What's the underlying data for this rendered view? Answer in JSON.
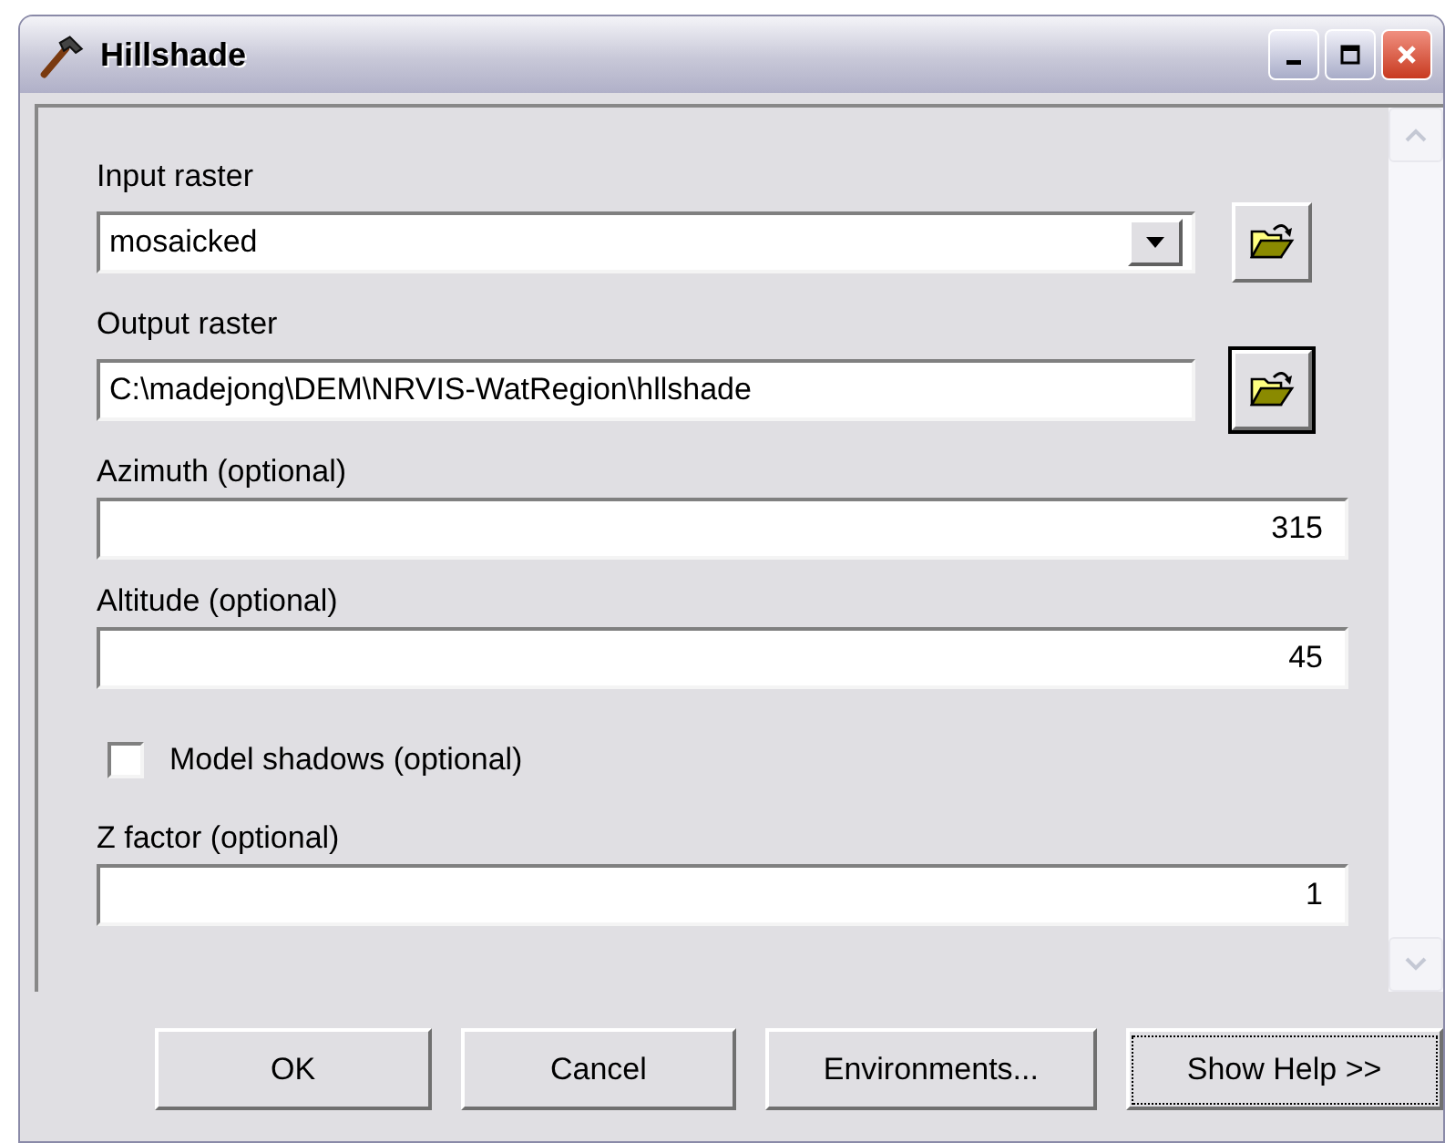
{
  "window": {
    "title": "Hillshade"
  },
  "parameters": [
    {
      "kind": "dropdown",
      "label": "Input raster",
      "value": "mosaicked"
    },
    {
      "kind": "path",
      "label": "Output raster",
      "value": "C:\\madejong\\DEM\\NRVIS-WatRegion\\hllshade"
    },
    {
      "kind": "number",
      "label": "Azimuth (optional)",
      "value": "315"
    },
    {
      "kind": "number",
      "label": "Altitude (optional)",
      "value": "45"
    },
    {
      "kind": "checkbox",
      "label": "Model shadows (optional)",
      "checked": false
    },
    {
      "kind": "number",
      "label": "Z factor (optional)",
      "value": "1"
    }
  ],
  "buttons": [
    {
      "label": "OK",
      "focused": false
    },
    {
      "label": "Cancel",
      "focused": false
    },
    {
      "label": "Environments...",
      "focused": false
    },
    {
      "label": "Show Help >>",
      "focused": true
    }
  ]
}
